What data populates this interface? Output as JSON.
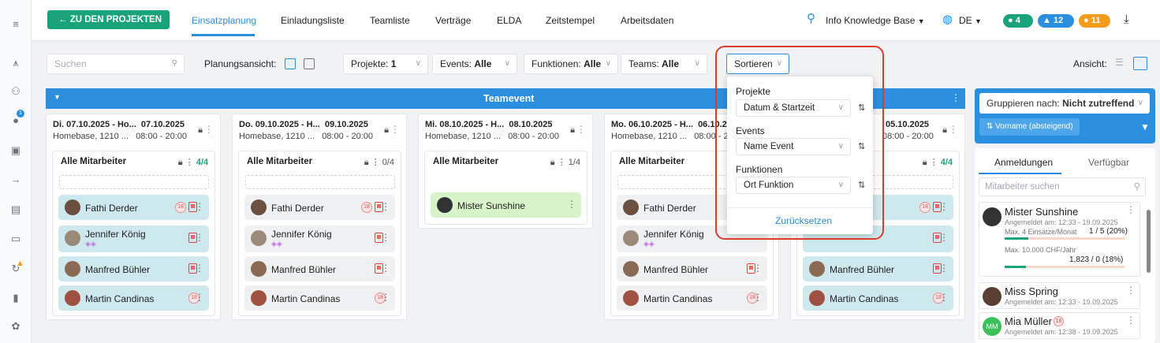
{
  "topbar": {
    "back_label": "ZU DEN PROJEKTEN",
    "tabs": [
      "Einsatzplanung",
      "Einladungsliste",
      "Teamliste",
      "Verträge",
      "ELDA",
      "Zeitstempel",
      "Arbeitsdaten"
    ],
    "kb_label": "Info Knowledge Base",
    "lang": "DE",
    "badges": {
      "chat": "4",
      "notif": "12",
      "alert": "11"
    }
  },
  "filters": {
    "search_placeholder": "Suchen",
    "planungsansicht_label": "Planungsansicht:",
    "projekte_label": "Projekte:",
    "projekte_value": "1",
    "events_label": "Events:",
    "events_value": "Alle",
    "funktionen_label": "Funktionen:",
    "funktionen_value": "Alle",
    "teams_label": "Teams:",
    "teams_value": "Alle",
    "sort_label": "Sortieren",
    "ansicht_label": "Ansicht:"
  },
  "teambar": {
    "title": "Teamevent"
  },
  "days": [
    {
      "line1": "Di. 07.10.2025 - Ho...",
      "date": "07.10.2025",
      "line2": "Homebase, 1210 ...",
      "time": "08:00 - 20:00",
      "group": "Alle Mitarbeiter",
      "count": "4/4"
    },
    {
      "line1": "Do. 09.10.2025 - H...",
      "date": "09.10.2025",
      "line2": "Homebase, 1210 ...",
      "time": "08:00 - 20:00",
      "group": "Alle Mitarbeiter",
      "count": "0/4"
    },
    {
      "line1": "Mi. 08.10.2025 - H...",
      "date": "08.10.2025",
      "line2": "Homebase, 1210 ...",
      "time": "08:00 - 20:00",
      "group": "Alle Mitarbeiter",
      "count": "1/4"
    },
    {
      "line1": "Mo. 06.10.2025 - H...",
      "date": "06.10.20",
      "line2": "Homebase, 1210 ...",
      "time": "08:00 - 2",
      "group": "Alle Mitarbeiter",
      "count": ""
    },
    {
      "line1": "",
      "date": "05.10.2025",
      "line2": "",
      "time": "08:00 - 20:00",
      "group": "",
      "count": "4/4"
    }
  ],
  "employees": {
    "fathi": "Fathi Derder",
    "jennifer": "Jennifer König",
    "manfred": "Manfred Bühler",
    "martin": "Martin Candinas",
    "sunshine": "Mister Sunshine",
    "badge18": "18"
  },
  "sort_popup": {
    "projekte_label": "Projekte",
    "projekte_value": "Datum & Startzeit",
    "events_label": "Events",
    "events_value": "Name Event",
    "funktionen_label": "Funktionen",
    "funktionen_value": "Ort Funktion",
    "reset_label": "Zurücksetzen"
  },
  "right_panel": {
    "group_label": "Gruppieren nach:",
    "group_value": "Nicht zutreffend",
    "sort_chip": "Vorname (absteigend)",
    "tab_anmeldungen": "Anmeldungen",
    "tab_verfuegbar": "Verfügbar",
    "search_placeholder": "Mitarbeiter suchen",
    "e1_name": "Mister Sunshine",
    "e1_date": "Angemeldet am: 12:33 - 19.09.2025",
    "e1_max1": "Max. 4 Einsätze/Monat",
    "e1_val1": "1 / 5 (20%)",
    "e1_max2": "Max. 10.000 CHF/Jahr",
    "e1_val2": "1,823 / 0 (18%)",
    "e2_name": "Miss Spring",
    "e2_date": "Angemeldet am: 12:33 - 19.09.2025",
    "e3_name": "Mia Müller",
    "e3_initials": "MM",
    "e3_date": "Angemeldet am: 12:38 - 19.09.2025"
  }
}
